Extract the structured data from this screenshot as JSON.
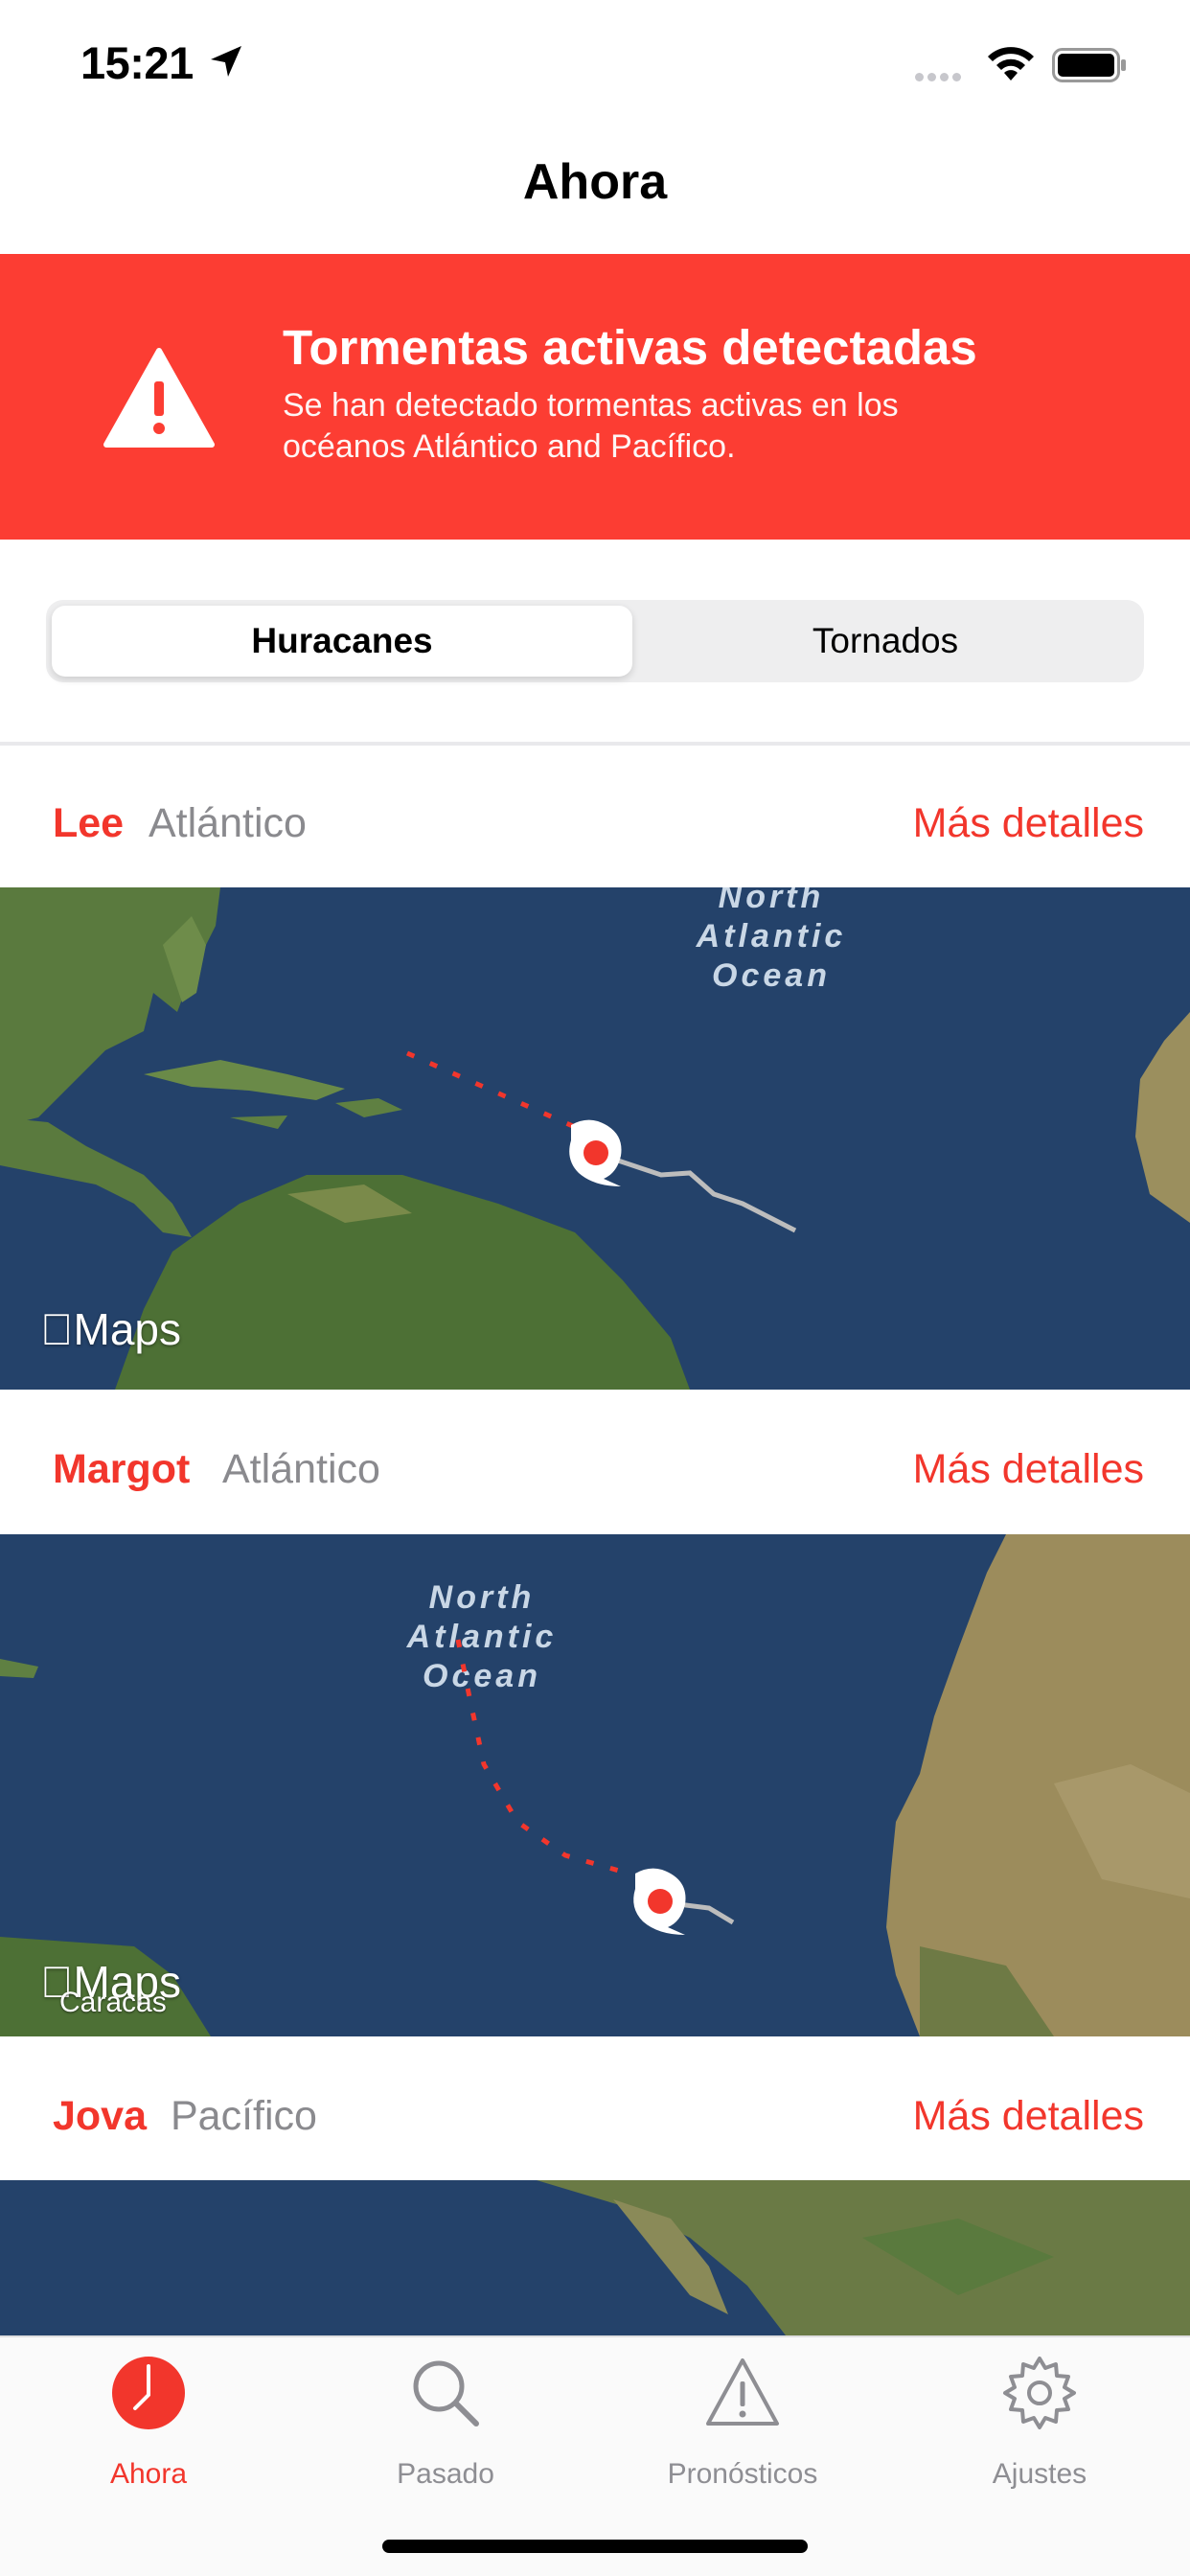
{
  "status_bar": {
    "time": "15:21"
  },
  "nav": {
    "title": "Ahora"
  },
  "alert": {
    "title": "Tormentas activas detectadas",
    "body_line1": "Se han detectado tormentas activas en los",
    "body_line2": "océanos Atlántico and Pacífico."
  },
  "segmented": {
    "selected": "Huracanes",
    "other": "Tornados"
  },
  "storms": [
    {
      "name": "Lee",
      "basin": "Atlántico",
      "details": "Más detalles"
    },
    {
      "name": "Margot",
      "basin": "Atlántico",
      "details": "Más detalles"
    },
    {
      "name": "Jova",
      "basin": "Pacífico",
      "details": "Más detalles"
    }
  ],
  "maps": {
    "logo_text": "Maps",
    "ocean_label_line1": "North",
    "ocean_label_line2": "Atlantic",
    "ocean_label_line3": "Ocean",
    "city_label": "Caracas"
  },
  "tabs": [
    {
      "label": "Ahora",
      "icon": "clock-icon",
      "active": true
    },
    {
      "label": "Pasado",
      "icon": "magnifier-icon",
      "active": false
    },
    {
      "label": "Pronósticos",
      "icon": "warning-triangle-icon",
      "active": false
    },
    {
      "label": "Ajustes",
      "icon": "gear-icon",
      "active": false
    }
  ],
  "colors": {
    "accent": "#f2362c",
    "alert_background": "#fc3d33",
    "ocean": "#24426a",
    "land": "#5e7d3e",
    "secondary_text": "#8a8a8e"
  }
}
